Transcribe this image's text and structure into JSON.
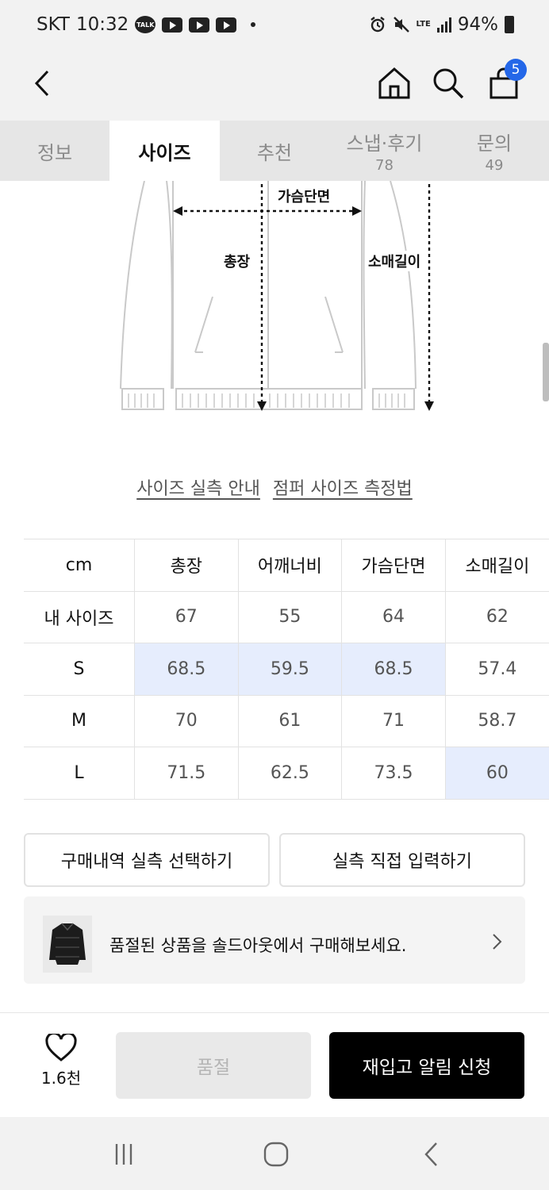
{
  "status_bar": {
    "carrier": "SKT",
    "time": "10:32",
    "talk_badge": "TALK",
    "network": "LTE",
    "battery": "94%"
  },
  "header": {
    "cart_count": "5"
  },
  "tabs": [
    {
      "label": "정보",
      "count": ""
    },
    {
      "label": "사이즈",
      "count": ""
    },
    {
      "label": "추천",
      "count": ""
    },
    {
      "label": "스냅·후기",
      "count": "78"
    },
    {
      "label": "문의",
      "count": "49"
    }
  ],
  "diagram": {
    "chest_label": "가슴단면",
    "length_label": "총장",
    "sleeve_label": "소매길이"
  },
  "links": {
    "size_guide": "사이즈 실측 안내",
    "measure_guide": "점퍼 사이즈 측정법"
  },
  "size_table": {
    "headers": [
      "cm",
      "총장",
      "어깨너비",
      "가슴단면",
      "소매길이"
    ],
    "rows": [
      {
        "label": "내 사이즈",
        "values": [
          "67",
          "55",
          "64",
          "62"
        ]
      },
      {
        "label": "S",
        "values": [
          "68.5",
          "59.5",
          "68.5",
          "57.4"
        ]
      },
      {
        "label": "M",
        "values": [
          "70",
          "61",
          "71",
          "58.7"
        ]
      },
      {
        "label": "L",
        "values": [
          "71.5",
          "62.5",
          "73.5",
          "60"
        ]
      }
    ],
    "highlight_color": "#e6edfd"
  },
  "buttons": {
    "purchase_history": "구매내역 실측 선택하기",
    "manual_input": "실측 직접 입력하기"
  },
  "banner": {
    "text": "품절된 상품을 솔드아웃에서 구매해보세요."
  },
  "bottom": {
    "like_count": "1.6천",
    "soldout": "품절",
    "restock": "재입고 알림 신청"
  },
  "colors": {
    "accent": "#2467e8",
    "primary_button": "#000000"
  }
}
